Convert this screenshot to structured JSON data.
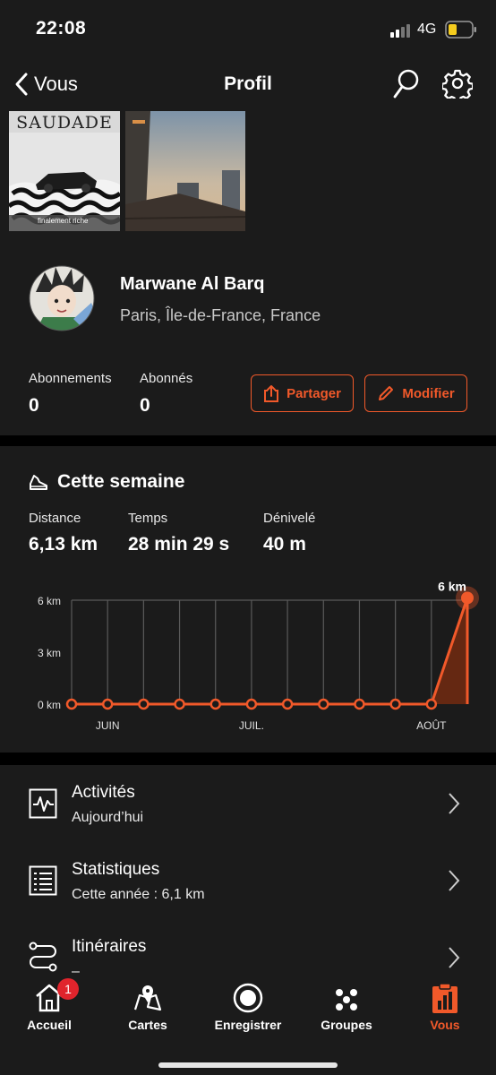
{
  "status_bar": {
    "time": "22:08",
    "network": "4G"
  },
  "nav": {
    "back_label": "Vous",
    "title": "Profil"
  },
  "gallery": {
    "photo1_title": "SAUDADE",
    "photo1_caption": "finalement riche"
  },
  "profile": {
    "name": "Marwane Al Barq",
    "location": "Paris, Île-de-France, France",
    "following_label": "Abonnements",
    "following_count": "0",
    "followers_label": "Abonnés",
    "followers_count": "0",
    "share_label": "Partager",
    "edit_label": "Modifier"
  },
  "week": {
    "title": "Cette semaine",
    "distance_label": "Distance",
    "distance_value": "6,13 km",
    "time_label": "Temps",
    "time_value": "28 min 29 s",
    "elevation_label": "Dénivelé",
    "elevation_value": "40 m"
  },
  "chart_data": {
    "type": "line",
    "x": [
      1,
      2,
      3,
      4,
      5,
      6,
      7,
      8,
      9,
      10,
      11,
      12
    ],
    "y": [
      0,
      0,
      0,
      0,
      0,
      0,
      0,
      0,
      0,
      0,
      0,
      6.13
    ],
    "y_ticks": [
      "6 km",
      "3 km",
      "0 km"
    ],
    "y_tick_values": [
      6,
      3,
      0
    ],
    "x_tick_labels": [
      {
        "label": "JUIN",
        "at": 2
      },
      {
        "label": "JUIL.",
        "at": 6
      },
      {
        "label": "AOÛT",
        "at": 11
      }
    ],
    "ylim": [
      0,
      6
    ],
    "highlight_label": "6 km",
    "color": "#f1592a",
    "grid": true
  },
  "menu": [
    {
      "title": "Activités",
      "subtitle": "Aujourd’hui"
    },
    {
      "title": "Statistiques",
      "subtitle": "Cette année : 6,1 km"
    },
    {
      "title": "Itinéraires",
      "subtitle": "–"
    }
  ],
  "tabs": [
    {
      "label": "Accueil",
      "badge": "1"
    },
    {
      "label": "Cartes"
    },
    {
      "label": "Enregistrer"
    },
    {
      "label": "Groupes"
    },
    {
      "label": "Vous"
    }
  ],
  "colors": {
    "accent": "#f1592a",
    "card": "#1b1b1b",
    "background": "#000000"
  }
}
